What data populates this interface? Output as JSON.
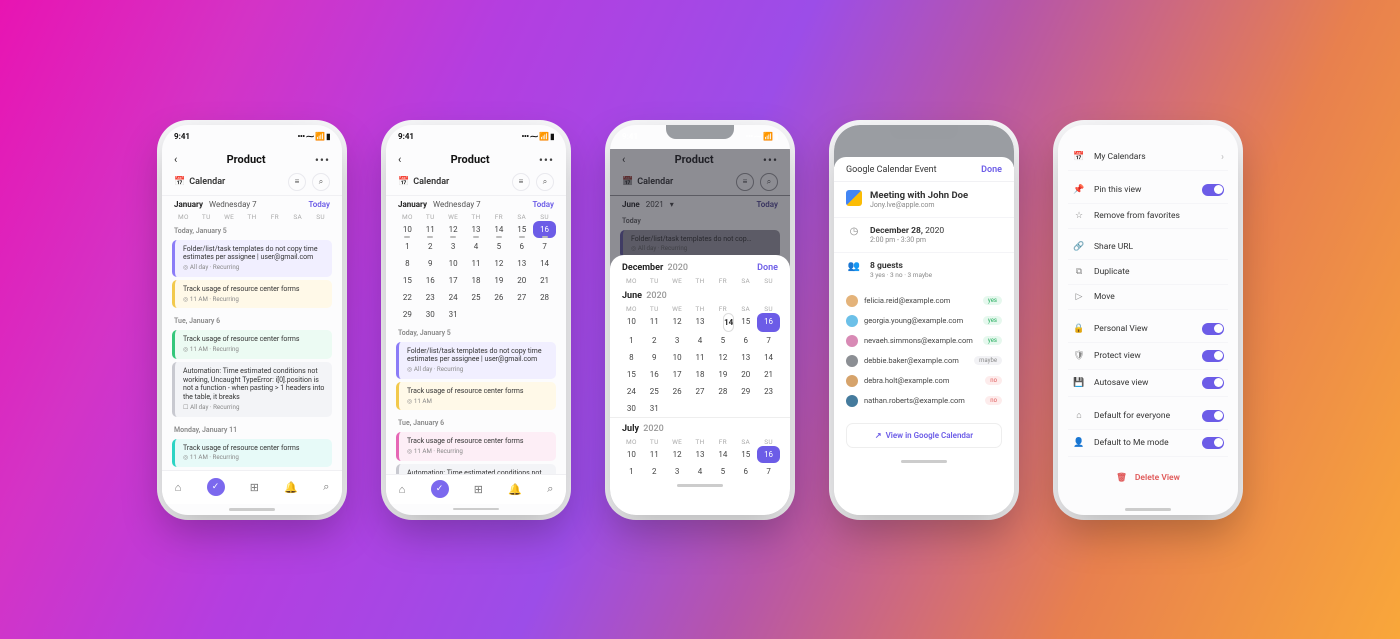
{
  "status": {
    "time": "9:41",
    "indicators": "••• ⁓ 📶 ▮"
  },
  "header": {
    "title": "Product"
  },
  "view": {
    "label": "Calendar",
    "month": "January",
    "weekday": "Wednesday 7",
    "today": "Today"
  },
  "weekdays": [
    "MO",
    "TU",
    "WE",
    "TH",
    "FR",
    "SA",
    "SU"
  ],
  "screen1": {
    "groups": [
      {
        "label": "Today, January 5",
        "tasks": [
          {
            "title": "Folder/list/task templates do not copy time estimates per assignee | user@gmail.com",
            "meta": "◎ All day · Recurring",
            "color": "purple"
          },
          {
            "title": "Track usage of resource center forms",
            "meta": "◎ 11 AM · Recurring",
            "color": "yellow"
          }
        ]
      },
      {
        "label": "Tue, January 6",
        "tasks": [
          {
            "title": "Track usage of resource center forms",
            "meta": "◎ 11 AM · Recurring",
            "color": "green"
          },
          {
            "title": "Automation: Time estimated conditions not working, Uncaught TypeError: i[0].position is not a function - when pasting > 1 headers into the table, it breaks",
            "meta": "☐ All day · Recurring",
            "color": "gray"
          }
        ]
      },
      {
        "label": "Monday, January 11",
        "tasks": [
          {
            "title": "Track usage of resource center forms",
            "meta": "◎ 11 AM · Recurring",
            "color": "teal"
          }
        ]
      }
    ]
  },
  "screen2": {
    "month_grid": [
      [
        "10",
        "11",
        "12",
        "13",
        "14",
        "15",
        "16"
      ],
      [
        "1",
        "2",
        "3",
        "4",
        "5",
        "6",
        "7"
      ],
      [
        "8",
        "9",
        "10",
        "11",
        "12",
        "13",
        "14"
      ],
      [
        "15",
        "16",
        "17",
        "18",
        "19",
        "20",
        "21"
      ],
      [
        "22",
        "23",
        "24",
        "25",
        "26",
        "27",
        "28"
      ],
      [
        "29",
        "30",
        "31",
        "",
        "",
        "",
        ""
      ]
    ],
    "selected": "16",
    "dotrow": 0,
    "groups": [
      {
        "label": "Today, January 5",
        "tasks": [
          {
            "title": "Folder/list/task templates do not copy time estimates per assignee | user@gmail.com",
            "meta": "◎ All day · Recurring",
            "color": "purple"
          },
          {
            "title": "Track usage of resource center forms",
            "meta": "◎ 11 AM",
            "color": "yellow"
          }
        ]
      },
      {
        "label": "Tue, January 6",
        "tasks": [
          {
            "title": "Track usage of resource center forms",
            "meta": "◎ 11 AM · Recurring",
            "color": "pink"
          },
          {
            "title": "Automation: Time estimated conditions not working, Uncaught",
            "meta": "",
            "color": "gray"
          }
        ]
      }
    ]
  },
  "screen3": {
    "bg_month": "June",
    "bg_year": "2021",
    "bg_dayhdr": "Today",
    "bg_task_title": "Folder/list/task templates do not cop…",
    "bg_task_meta": "◎ All day · Recurring",
    "sheet_title_m": "December",
    "sheet_title_y": "2020",
    "done": "Done",
    "months": [
      {
        "label_m": "June",
        "label_y": "2020",
        "selected": "16",
        "today": "14",
        "rows": [
          [
            "10",
            "11",
            "12",
            "13",
            "14",
            "15",
            "16"
          ],
          [
            "1",
            "2",
            "3",
            "4",
            "5",
            "6",
            "7"
          ],
          [
            "8",
            "9",
            "10",
            "11",
            "12",
            "13",
            "14"
          ],
          [
            "15",
            "16",
            "17",
            "18",
            "19",
            "20",
            "21"
          ],
          [
            "24",
            "25",
            "26",
            "27",
            "28",
            "29",
            "23"
          ],
          [
            "30",
            "31",
            "",
            "",
            "",
            "",
            ""
          ]
        ]
      },
      {
        "label_m": "July",
        "label_y": "2020",
        "selected": "16",
        "today": "",
        "rows": [
          [
            "10",
            "11",
            "12",
            "13",
            "14",
            "15",
            "16"
          ],
          [
            "1",
            "2",
            "3",
            "4",
            "5",
            "6",
            "7"
          ]
        ]
      }
    ]
  },
  "screen4": {
    "sheet_title": "Google Calendar Event",
    "done": "Done",
    "event_title": "Meeting with John Doe",
    "event_sub": "Jony.Ive@apple.com",
    "date_bold": "December 28,",
    "date_year": "2020",
    "time": "2:00 pm - 3:30 pm",
    "guests_n": "8 guests",
    "summary": "3 yes · 3 no · 3 maybe",
    "guests": [
      {
        "email": "felicia.reid@example.com",
        "status": "yes",
        "av": "#e4b37a"
      },
      {
        "email": "georgia.young@example.com",
        "status": "yes",
        "av": "#6cc0e8"
      },
      {
        "email": "nevaeh.simmons@example.com",
        "status": "yes",
        "av": "#d88ab5"
      },
      {
        "email": "debbie.baker@example.com",
        "status": "maybe",
        "av": "#8c8f94"
      },
      {
        "email": "debra.holt@example.com",
        "status": "no",
        "av": "#d6a36b"
      },
      {
        "email": "nathan.roberts@example.com",
        "status": "no",
        "av": "#457b9d"
      }
    ],
    "view_in": "View in Google Calendar"
  },
  "screen5": {
    "items": [
      {
        "icon": "📅",
        "label": "My Calendars",
        "kind": "chev"
      },
      {
        "icon": "📌",
        "label": "Pin this view",
        "kind": "toggle"
      },
      {
        "icon": "☆",
        "label": "Remove from favorites",
        "kind": "plain"
      },
      {
        "icon": "🔗",
        "label": "Share URL",
        "kind": "plain"
      },
      {
        "icon": "⧉",
        "label": "Duplicate",
        "kind": "plain"
      },
      {
        "icon": "▷",
        "label": "Move",
        "kind": "plain"
      },
      {
        "icon": "🔒",
        "label": "Personal View",
        "kind": "toggle"
      },
      {
        "icon": "🛡",
        "label": "Protect view",
        "kind": "toggle"
      },
      {
        "icon": "💾",
        "label": "Autosave view",
        "kind": "toggle"
      },
      {
        "icon": "⌂",
        "label": "Default for everyone",
        "kind": "toggle"
      },
      {
        "icon": "👤",
        "label": "Default to Me mode",
        "kind": "toggle"
      }
    ],
    "delete": "Delete View"
  }
}
